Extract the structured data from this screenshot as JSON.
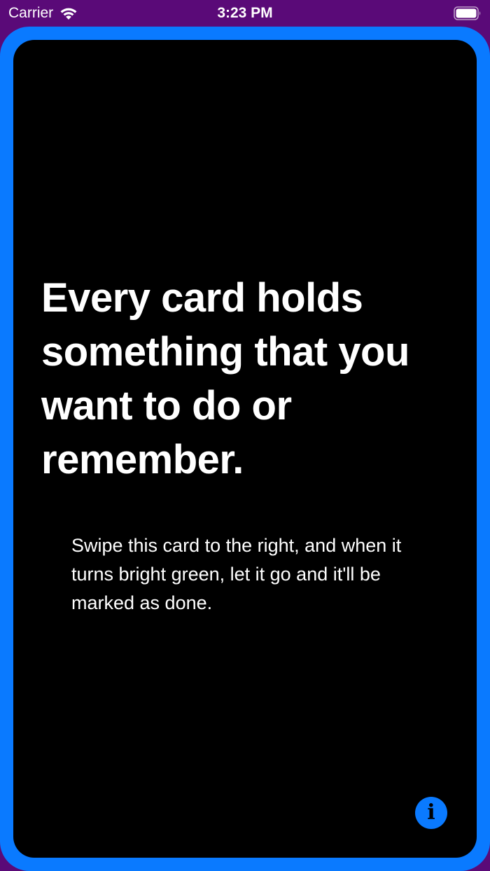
{
  "status_bar": {
    "carrier": "Carrier",
    "time": "3:23 PM",
    "wifi_icon": "wifi-icon",
    "battery_icon": "battery-icon"
  },
  "card": {
    "title": "Every card holds something that you want to do or remember.",
    "body": "Swipe this card to the right, and when it turns bright green, let it go and it'll be marked as done.",
    "info_glyph": "i"
  },
  "colors": {
    "background": "#5a0a78",
    "card_frame": "#0a7aff",
    "card": "#000000",
    "text": "#ffffff",
    "info_button": "#0a7aff"
  }
}
